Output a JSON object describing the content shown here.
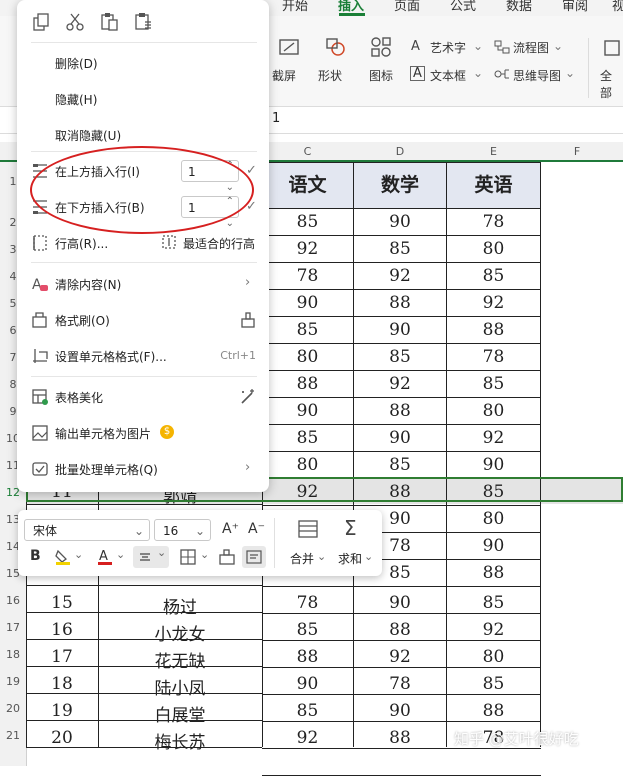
{
  "ribbon": {
    "tabs": [
      "开始",
      "插入",
      "页面",
      "公式",
      "数据",
      "审阅",
      "视"
    ],
    "active_tab": "插入",
    "row1": [
      "截屏",
      "形状",
      "图标",
      "艺术字",
      "文本框",
      "流程图",
      "思维导图",
      "全部"
    ],
    "formula_value": "1"
  },
  "columns": [
    "C",
    "D",
    "E",
    "F"
  ],
  "row_numbers": [
    "1",
    "2",
    "3",
    "4",
    "5",
    "6",
    "7",
    "8",
    "9",
    "10",
    "11",
    "12",
    "13",
    "14",
    "15",
    "16",
    "17",
    "18",
    "19",
    "20",
    "21"
  ],
  "table": {
    "headers": [
      "语文",
      "数学",
      "英语"
    ],
    "rows_top": [
      [
        "85",
        "90",
        "78"
      ],
      [
        "92",
        "85",
        "80"
      ],
      [
        "78",
        "92",
        "85"
      ],
      [
        "90",
        "88",
        "92"
      ],
      [
        "85",
        "90",
        "88"
      ],
      [
        "80",
        "85",
        "78"
      ],
      [
        "88",
        "92",
        "85"
      ],
      [
        "90",
        "88",
        "80"
      ],
      [
        "85",
        "90",
        "92"
      ],
      [
        "80",
        "85",
        "90"
      ]
    ],
    "selected_row": {
      "num": "11",
      "name": "郭靖",
      "scores": [
        "92",
        "88",
        "85"
      ]
    },
    "partial_rows": [
      [
        "90",
        "80"
      ],
      [
        "78",
        "90"
      ],
      [
        "85",
        "88"
      ]
    ],
    "partial_row_num": "14",
    "rows_bottom": [
      {
        "num": "15",
        "name": "杨过",
        "scores": [
          "78",
          "90",
          "85"
        ]
      },
      {
        "num": "16",
        "name": "小龙女",
        "scores": [
          "85",
          "88",
          "92"
        ]
      },
      {
        "num": "17",
        "name": "花无缺",
        "scores": [
          "88",
          "92",
          "80"
        ]
      },
      {
        "num": "18",
        "name": "陆小凤",
        "scores": [
          "90",
          "78",
          "85"
        ]
      },
      {
        "num": "19",
        "name": "白展堂",
        "scores": [
          "85",
          "90",
          "88"
        ]
      },
      {
        "num": "20",
        "name": "梅长苏",
        "scores": [
          "92",
          "88",
          "78"
        ]
      }
    ]
  },
  "context_menu": {
    "delete": "删除(D)",
    "hide": "隐藏(H)",
    "unhide": "取消隐藏(U)",
    "insert_above": "在上方插入行(I)",
    "insert_above_value": "1",
    "insert_below": "在下方插入行(B)",
    "insert_below_value": "1",
    "row_height": "行高(R)...",
    "best_fit": "最适合的行高",
    "clear": "清除内容(N)",
    "format_painter": "格式刷(O)",
    "format_cells": "设置单元格格式(F)...",
    "format_cells_shortcut": "Ctrl+1",
    "beautify": "表格美化",
    "export_image": "输出单元格为图片",
    "batch": "批量处理单元格(Q)"
  },
  "mini_toolbar": {
    "font": "宋体",
    "size": "16",
    "merge": "合并",
    "sum": "求和"
  },
  "watermark": "知乎 @艾叶很好吃",
  "colors": {
    "accent": "#1a7f37",
    "annotation": "#d62020",
    "header_fill": "#e3e7f1"
  }
}
